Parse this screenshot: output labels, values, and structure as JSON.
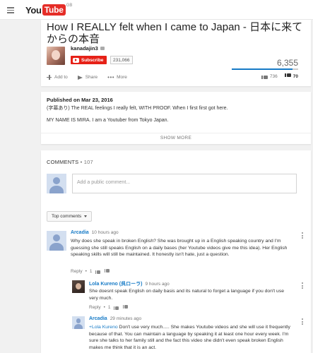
{
  "masthead": {
    "logo_you": "You",
    "logo_tube": "Tube",
    "country": "GB"
  },
  "video": {
    "title": "How I REALLY felt when I came to Japan - 日本に来てからの本音",
    "channel_name": "kanadajin3",
    "subscribe_label": "Subscribe",
    "subscriber_count": "231,066",
    "view_count": "6,355",
    "like_ratio": 0.91,
    "actions": {
      "add_to": "Add to",
      "share": "Share",
      "more": "More"
    },
    "likes": "736",
    "dislikes": "70"
  },
  "description": {
    "published": "Published on Mar 23, 2016",
    "line1": "(字幕あり) The REAL feelings I really felt, WITH PROOF. When I first first got here.",
    "line2": "MY NAME IS MIRA. I am a Youtuber from Tokyo Japan.",
    "show_more": "SHOW MORE"
  },
  "comments": {
    "header": "COMMENTS",
    "count": "107",
    "placeholder": "Add a public comment...",
    "sort_label": "Top comments",
    "items": [
      {
        "author": "Arcadia",
        "time": "10 hours ago",
        "body": "Why does she speak in broken English? She was brought up in a English speaking country and I'm guessing she still speaks English on a daily bases (her Youtube videos give me this idea). Her English speaking skills will still be maintained. It honestly isn't hate, just a question.",
        "reply_label": "Reply",
        "likes": "1"
      },
      {
        "author": "Lola Kureno (呉ローラ)",
        "time": "9 hours ago",
        "body": "She doesnt speak English on daily basis and its natural to forget a language if you don't use very much.",
        "reply_label": "Reply",
        "likes": "1"
      },
      {
        "author": "Arcadia",
        "time": "29 minutes ago",
        "mention": "+Lola Kureno",
        "body": " Don't use very much..... She makes Youtube videos and she will use it frequently because of that. You can maintain a language by speaking it at least one hour every week. I'm sure she talks to her family still and the fact this video she didn't even speak broken English makes me think that it is an act."
      }
    ]
  }
}
